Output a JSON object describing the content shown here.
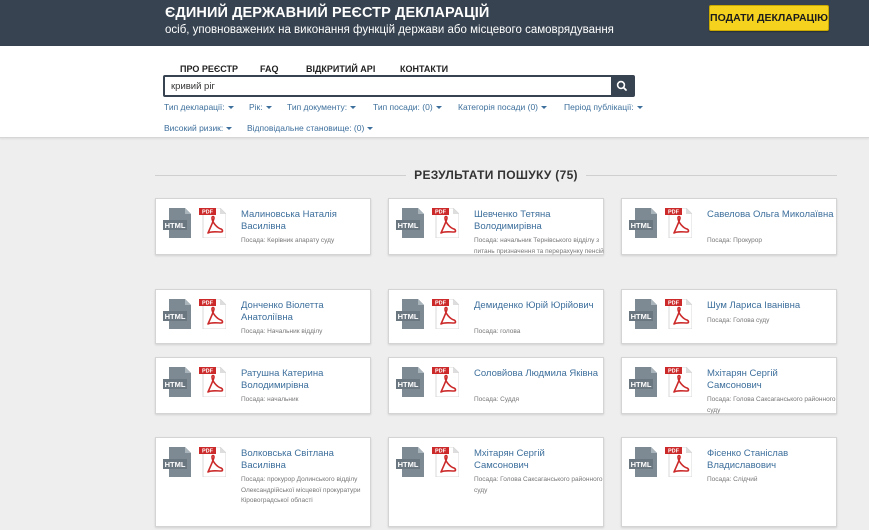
{
  "header": {
    "title": "ЄДИНИЙ ДЕРЖАВНИЙ РЕЄСТР ДЕКЛАРАЦІЙ",
    "subtitle": "осіб, уповноважених на виконання функцій держави або місцевого самоврядування",
    "submit_label": "ПОДАТИ ДЕКЛАРАЦІЮ"
  },
  "nav": {
    "items": [
      "ПРО РЕЄСТР",
      "FAQ",
      "ВІДКРИТИЙ API",
      "КОНТАКТИ"
    ]
  },
  "search": {
    "value": "кривий ріг",
    "icon": "search-icon"
  },
  "filters": [
    "Тип декларації:",
    "Рік:",
    "Тип документу:",
    "Тип посади: (0)",
    "Категорія посади (0)",
    "Період публікації:",
    "Високий ризик:",
    "Відповідальне становище: (0)"
  ],
  "results": {
    "title": "РЕЗУЛЬТАТИ ПОШУКУ (75)",
    "html_label": "HTML",
    "pdf_label": "PDF",
    "items": [
      {
        "name": "Малиновська Наталія Василівна",
        "position": "Посада: Керівник апарату суду"
      },
      {
        "name": "Шевченко Тетяна Володимирівна",
        "position": "Посада: начальник Тернівського відділу з питань призначення та перерахунку пенсій"
      },
      {
        "name": "Савелова Ольга Миколаївна",
        "position": "Посада: Прокурор"
      },
      {
        "name": "Донченко Віолетта Анатоліївна",
        "position": "Посада: Начальник відділу"
      },
      {
        "name": "Демиденко Юрій Юрійович",
        "position": "Посада: голова"
      },
      {
        "name": "Шум Лариса Іванівна",
        "position": "Посада: Голова суду"
      },
      {
        "name": "Ратушна Катерина Володимирівна",
        "position": "Посада: начальник"
      },
      {
        "name": "Соловйова Людмила Яківна",
        "position": "Посада: Суддя"
      },
      {
        "name": "Мхітарян Сергій Самсонович",
        "position": "Посада: Голова Саксаганського районного суду"
      },
      {
        "name": "Волковська Світлана Василівна",
        "position": "Посада: прокурор Долинського відділу Олександрійської місцевої прокуратури Кіровоградської області"
      },
      {
        "name": "Мхітарян Сергій Самсонович",
        "position": "Посада: Голова Саксаганського районного суду"
      },
      {
        "name": "Фісенко Станіслав Владиславович",
        "position": "Посада: Слідчий"
      }
    ]
  },
  "colors": {
    "header_bg": "#374350",
    "accent_yellow": "#f5d21e",
    "link_blue": "#3d6f9c",
    "pdf_red": "#cc2a2a",
    "html_gray": "#6f7c86"
  }
}
